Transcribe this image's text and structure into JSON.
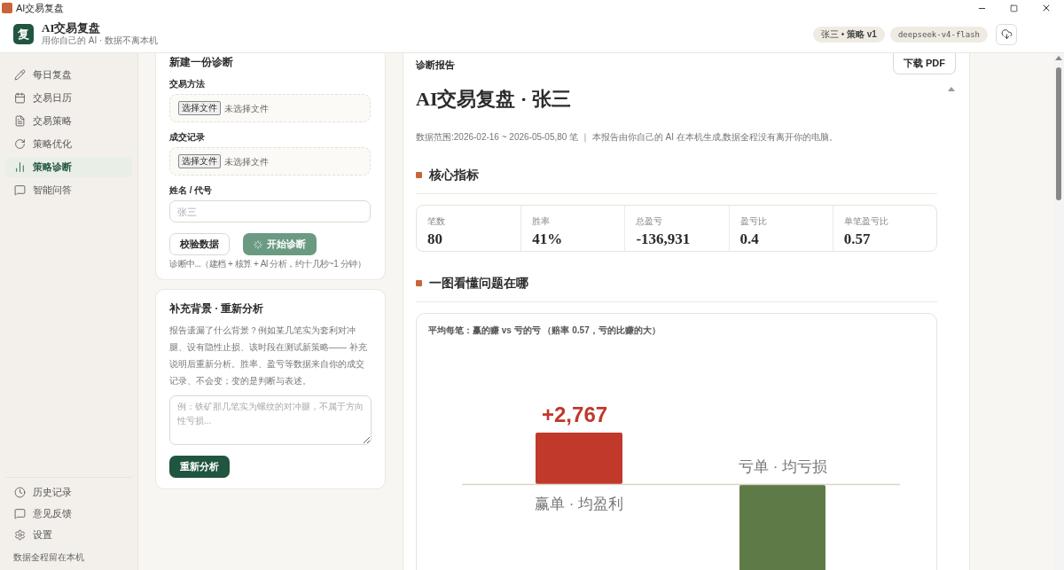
{
  "window": {
    "title": "AI交易复盘"
  },
  "header": {
    "logo": "复",
    "app_name": "AI交易复盘",
    "tagline": "用你自己的 AI · 数据不离本机",
    "profile_badge": "张三 • **策略 v1**",
    "model_badge": "deepseek-v4-flash"
  },
  "sidebar": {
    "items": [
      {
        "label": "每日复盘",
        "selected": false
      },
      {
        "label": "交易日历",
        "selected": false
      },
      {
        "label": "交易策略",
        "selected": false
      },
      {
        "label": "策略优化",
        "selected": false
      },
      {
        "label": "策略诊断",
        "selected": true
      },
      {
        "label": "智能问答",
        "selected": false
      }
    ],
    "footer_items": [
      {
        "label": "历史记录"
      },
      {
        "label": "意见反馈"
      },
      {
        "label": "设置"
      }
    ],
    "note": "数据全程留在本机"
  },
  "new_diagnosis": {
    "title": "新建一份诊断",
    "file_fields": [
      {
        "label": "交易方法",
        "button": "选择文件",
        "status": "未选择文件"
      },
      {
        "label": "成交记录",
        "button": "选择文件",
        "status": "未选择文件"
      }
    ],
    "name_field": {
      "label": "姓名 / 代号",
      "placeholder": "张三"
    },
    "validate_button": "校验数据",
    "start_button": {
      "label": "开始诊断",
      "loading": true
    },
    "status": "诊断中...（建档 + 核算 + AI 分析，约十几秒~1 分钟）"
  },
  "reanalyze": {
    "title": "补充背景 · 重新分析",
    "description": "报告遗漏了什么背景？例如某几笔实为套利对冲腿、设有隐性止损、该时段在测试新策略—— 补充说明后重新分析。胜率、盈亏等数据来自你的成交记录、不会变；变的是判断与表述。",
    "placeholder": "例：铁矿那几笔实为螺纹的对冲腿，不属于方向性亏损...",
    "button": "重新分析"
  },
  "report": {
    "label": "诊断报告",
    "download_button": "下载 PDF",
    "title": "AI交易复盘 · 张三",
    "meta": "数据范围:2026-02-16 ~ 2026-05-05,80 笔 ｜ 本报告由你自己的 AI 在本机生成,数据全程没有离开你的电脑。",
    "sections": [
      {
        "title": "核心指标"
      },
      {
        "title": "一图看懂问题在哪"
      }
    ],
    "metrics": [
      {
        "label": "笔数",
        "value": "80"
      },
      {
        "label": "胜率",
        "value": "41%"
      },
      {
        "label": "总盈亏",
        "value": "-136,931"
      },
      {
        "label": "盈亏比",
        "value": "0.4"
      },
      {
        "label": "单笔盈亏比",
        "value": "0.57"
      }
    ],
    "chart": {
      "title": "平均每笔：赢的赚 vs 亏的亏 （赔率 0.57，亏的比赚的大）",
      "win_value": "+2,767",
      "win_label": "赢单 · 均盈利",
      "loss_label": "亏单 · 均亏损"
    }
  }
}
